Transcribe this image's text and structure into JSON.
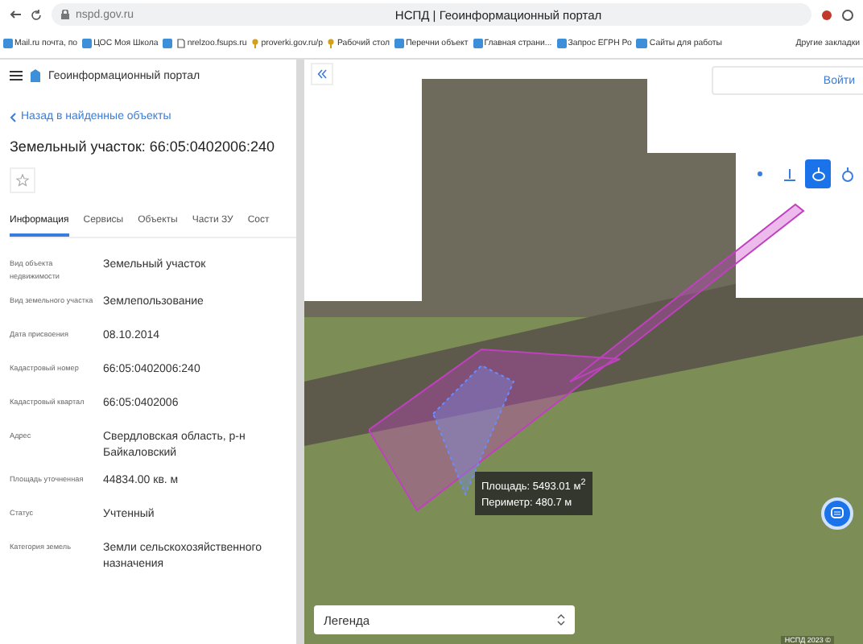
{
  "browser": {
    "url": "nspd.gov.ru",
    "title": "НСПД | Геоинформационный портал",
    "bookmarks": [
      {
        "label": "Mail.ru почта, по",
        "kind": "page"
      },
      {
        "label": "ЦОС Моя Школа",
        "kind": "page"
      },
      {
        "kind": "page"
      },
      {
        "label": "nrelzoo.fsups.ru",
        "kind": "doc"
      },
      {
        "label": "proverki.gov.ru/p",
        "kind": "pin"
      },
      {
        "label": "Рабочий стол",
        "kind": "pin"
      },
      {
        "label": "Перечни объект",
        "kind": "page"
      },
      {
        "label": "Главная страни...",
        "kind": "page"
      },
      {
        "label": "Запрос ЕГРН Ро",
        "kind": "page"
      },
      {
        "label": "Сайты для работы",
        "kind": "folder"
      }
    ],
    "more_label": "Другие закладки"
  },
  "panel": {
    "portal_title": "Геоинформационный портал",
    "back_link": "Назад в найденные объекты",
    "object_title": "Земельный участок: 66:05:0402006:240",
    "tabs": [
      {
        "label": "Информация",
        "selected": true
      },
      {
        "label": "Сервисы",
        "selected": false
      },
      {
        "label": "Объекты",
        "selected": false
      },
      {
        "label": "Части ЗУ",
        "selected": false
      },
      {
        "label": "Сост",
        "selected": false
      }
    ],
    "properties": [
      {
        "label": "Вид объекта недвижимости",
        "value": "Земельный участок"
      },
      {
        "label": "Вид земельного участка",
        "value": "Землепользование"
      },
      {
        "label": "Дата присвоения",
        "value": "08.10.2014"
      },
      {
        "label": "Кадастровый номер",
        "value": "66:05:0402006:240"
      },
      {
        "label": "Кадастровый квартал",
        "value": "66:05:0402006"
      },
      {
        "label": "Адрес",
        "value": "Свердловская область, р-н Байкаловский"
      },
      {
        "label": "Площадь уточненная",
        "value": "44834.00 кв. м"
      },
      {
        "label": "Статус",
        "value": "Учтенный"
      },
      {
        "label": "Категория земель",
        "value": "Земли сельскохозяйственного назначения"
      }
    ]
  },
  "map": {
    "login_label": "Войти",
    "tools": [
      {
        "kind": "point",
        "selected": false
      },
      {
        "kind": "line",
        "selected": false
      },
      {
        "kind": "area",
        "selected": true
      },
      {
        "kind": "circle",
        "selected": false
      }
    ],
    "measure": {
      "area": "Площадь: 5493.01 м$^{2}$",
      "perimeter": "Периметр: 480.7 м"
    },
    "legend": "Легенда",
    "attribution": "НСПД 2023 ©"
  }
}
